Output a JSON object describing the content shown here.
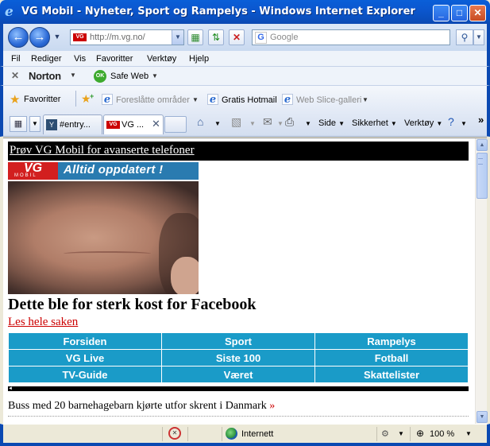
{
  "window": {
    "title": "VG Mobil - Nyheter, Sport og Rampelys - Windows Internet Explorer",
    "min_label": "_",
    "max_label": "□",
    "close_label": "✕"
  },
  "address_bar": {
    "url": "http://m.vg.no/",
    "favicon_text": "VG"
  },
  "search": {
    "provider_letter": "G",
    "placeholder": "Google"
  },
  "menu": {
    "items": [
      "Fil",
      "Rediger",
      "Vis",
      "Favoritter",
      "Verktøy",
      "Hjelp"
    ]
  },
  "norton": {
    "close": "✕",
    "brand": "Norton",
    "badge": "OK",
    "safe_web": "Safe Web"
  },
  "favorites_bar": {
    "favorites_label": "Favoritter",
    "links": [
      "Foreslåtte områder",
      "Gratis Hotmail",
      "Web Slice-galleri"
    ]
  },
  "tabs": [
    {
      "label": "#entry...",
      "icon_text": "Y"
    },
    {
      "label": "VG ...",
      "icon_text": "VG"
    }
  ],
  "command_bar": {
    "page_label": "Side",
    "safety_label": "Sikkerhet",
    "tools_label": "Verktøy",
    "more": "»"
  },
  "page": {
    "promo_link": "Prøv VG Mobil for avanserte telefoner",
    "logo_text": "VG",
    "logo_sub": "MOBIL",
    "slogan": "Alltid oppdatert !",
    "headline": "Dette ble for sterk kost for Facebook",
    "read_more": "Les hele saken",
    "nav_grid": [
      [
        "Forsiden",
        "Sport",
        "Rampelys"
      ],
      [
        "VG Live",
        "Siste 100",
        "Fotball"
      ],
      [
        "TV-Guide",
        "Været",
        "Skattelister"
      ]
    ],
    "divider_glyph": "◄",
    "news_item": "Buss med 20 barnehagebarn kjørte utfor skrent i Danmark",
    "news_arrow": "»"
  },
  "status_bar": {
    "zone": "Internett",
    "zoom": "100 %"
  },
  "icons": {
    "back": "back-arrow-icon",
    "forward": "forward-arrow-icon",
    "refresh": "refresh-icon",
    "stop": "stop-icon",
    "search": "search-icon",
    "star": "star-icon",
    "home": "home-icon",
    "feed": "rss-feed-icon",
    "mail": "mail-icon",
    "print": "printer-icon",
    "help": "help-icon"
  },
  "colors": {
    "title_blue": "#0A5FD8",
    "vg_red": "#D21F1F",
    "nav_cyan": "#1A9BC8",
    "link_red": "#CC0000"
  }
}
